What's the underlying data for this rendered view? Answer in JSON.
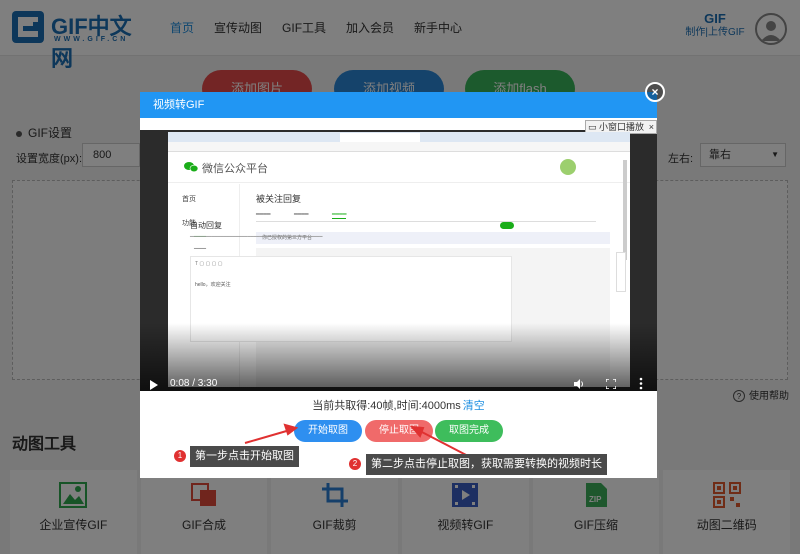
{
  "header": {
    "logo_text": "GIF中文网",
    "logo_sub": "WWW.GIF.CN",
    "nav": [
      "首页",
      "宣传动图",
      "GIF工具",
      "加入会员",
      "新手中心"
    ],
    "upload_big": "GIF",
    "upload_small": "制作|上传GIF"
  },
  "page": {
    "btn_add_image": "添加图片",
    "btn_add_video": "添加视频",
    "btn_add_flash": "添加flash",
    "gif_settings": "GIF设置",
    "width_label": "设置宽度(px):",
    "width_value": "800",
    "lr_label": "左右:",
    "lr_value": "靠右",
    "help": "使用帮助",
    "tools_title": "动图工具",
    "tools": [
      "企业宣传GIF",
      "GIF合成",
      "GIF裁剪",
      "视频转GIF",
      "GIF压缩",
      "动图二维码"
    ]
  },
  "modal": {
    "title": "视频转GIF",
    "close": "×",
    "mini_play": "小窗口播放",
    "mini_close": "×",
    "time": "0:08 / 3:30",
    "progress": 0.038,
    "frame_info": "当前共取得:40帧,时间:4000ms",
    "clear": "清空",
    "btn_start": "开始取图",
    "btn_stop": "停止取图",
    "btn_done": "取图完成"
  },
  "video_content": {
    "platform_title": "微信公众平台",
    "page_title": "被关注回复",
    "side_home": "首页",
    "side_func": "功能",
    "notice": "你已授权的第三方平台",
    "auto_reply": "自动回复",
    "text_line": "hello，欢迎关注"
  },
  "callouts": {
    "step1_num": "1",
    "step1_text": "第一步点击开始取图",
    "step2_num": "2",
    "step2_text": "第二步点击停止取图，获取需要转换的视频时长"
  },
  "colors": {
    "modal_header": "#2196f3",
    "start": "#2e8ff0",
    "stop": "#f06a6a",
    "done": "#3ebd5c",
    "callout_num": "#e03131"
  }
}
